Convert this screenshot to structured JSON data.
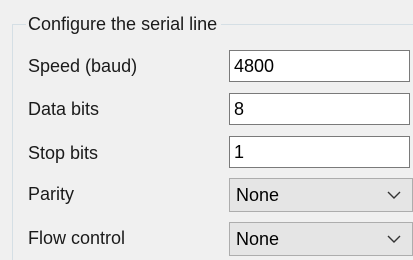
{
  "group": {
    "title": "Configure the serial line"
  },
  "fields": {
    "speed": {
      "label": "Speed (baud)",
      "value": "4800"
    },
    "data_bits": {
      "label": "Data bits",
      "value": "8"
    },
    "stop_bits": {
      "label": "Stop bits",
      "value": "1"
    },
    "parity": {
      "label": "Parity",
      "value": "None"
    },
    "flow_control": {
      "label": "Flow control",
      "value": "None"
    }
  },
  "icons": {
    "dropdown": "chevron-down-icon"
  }
}
